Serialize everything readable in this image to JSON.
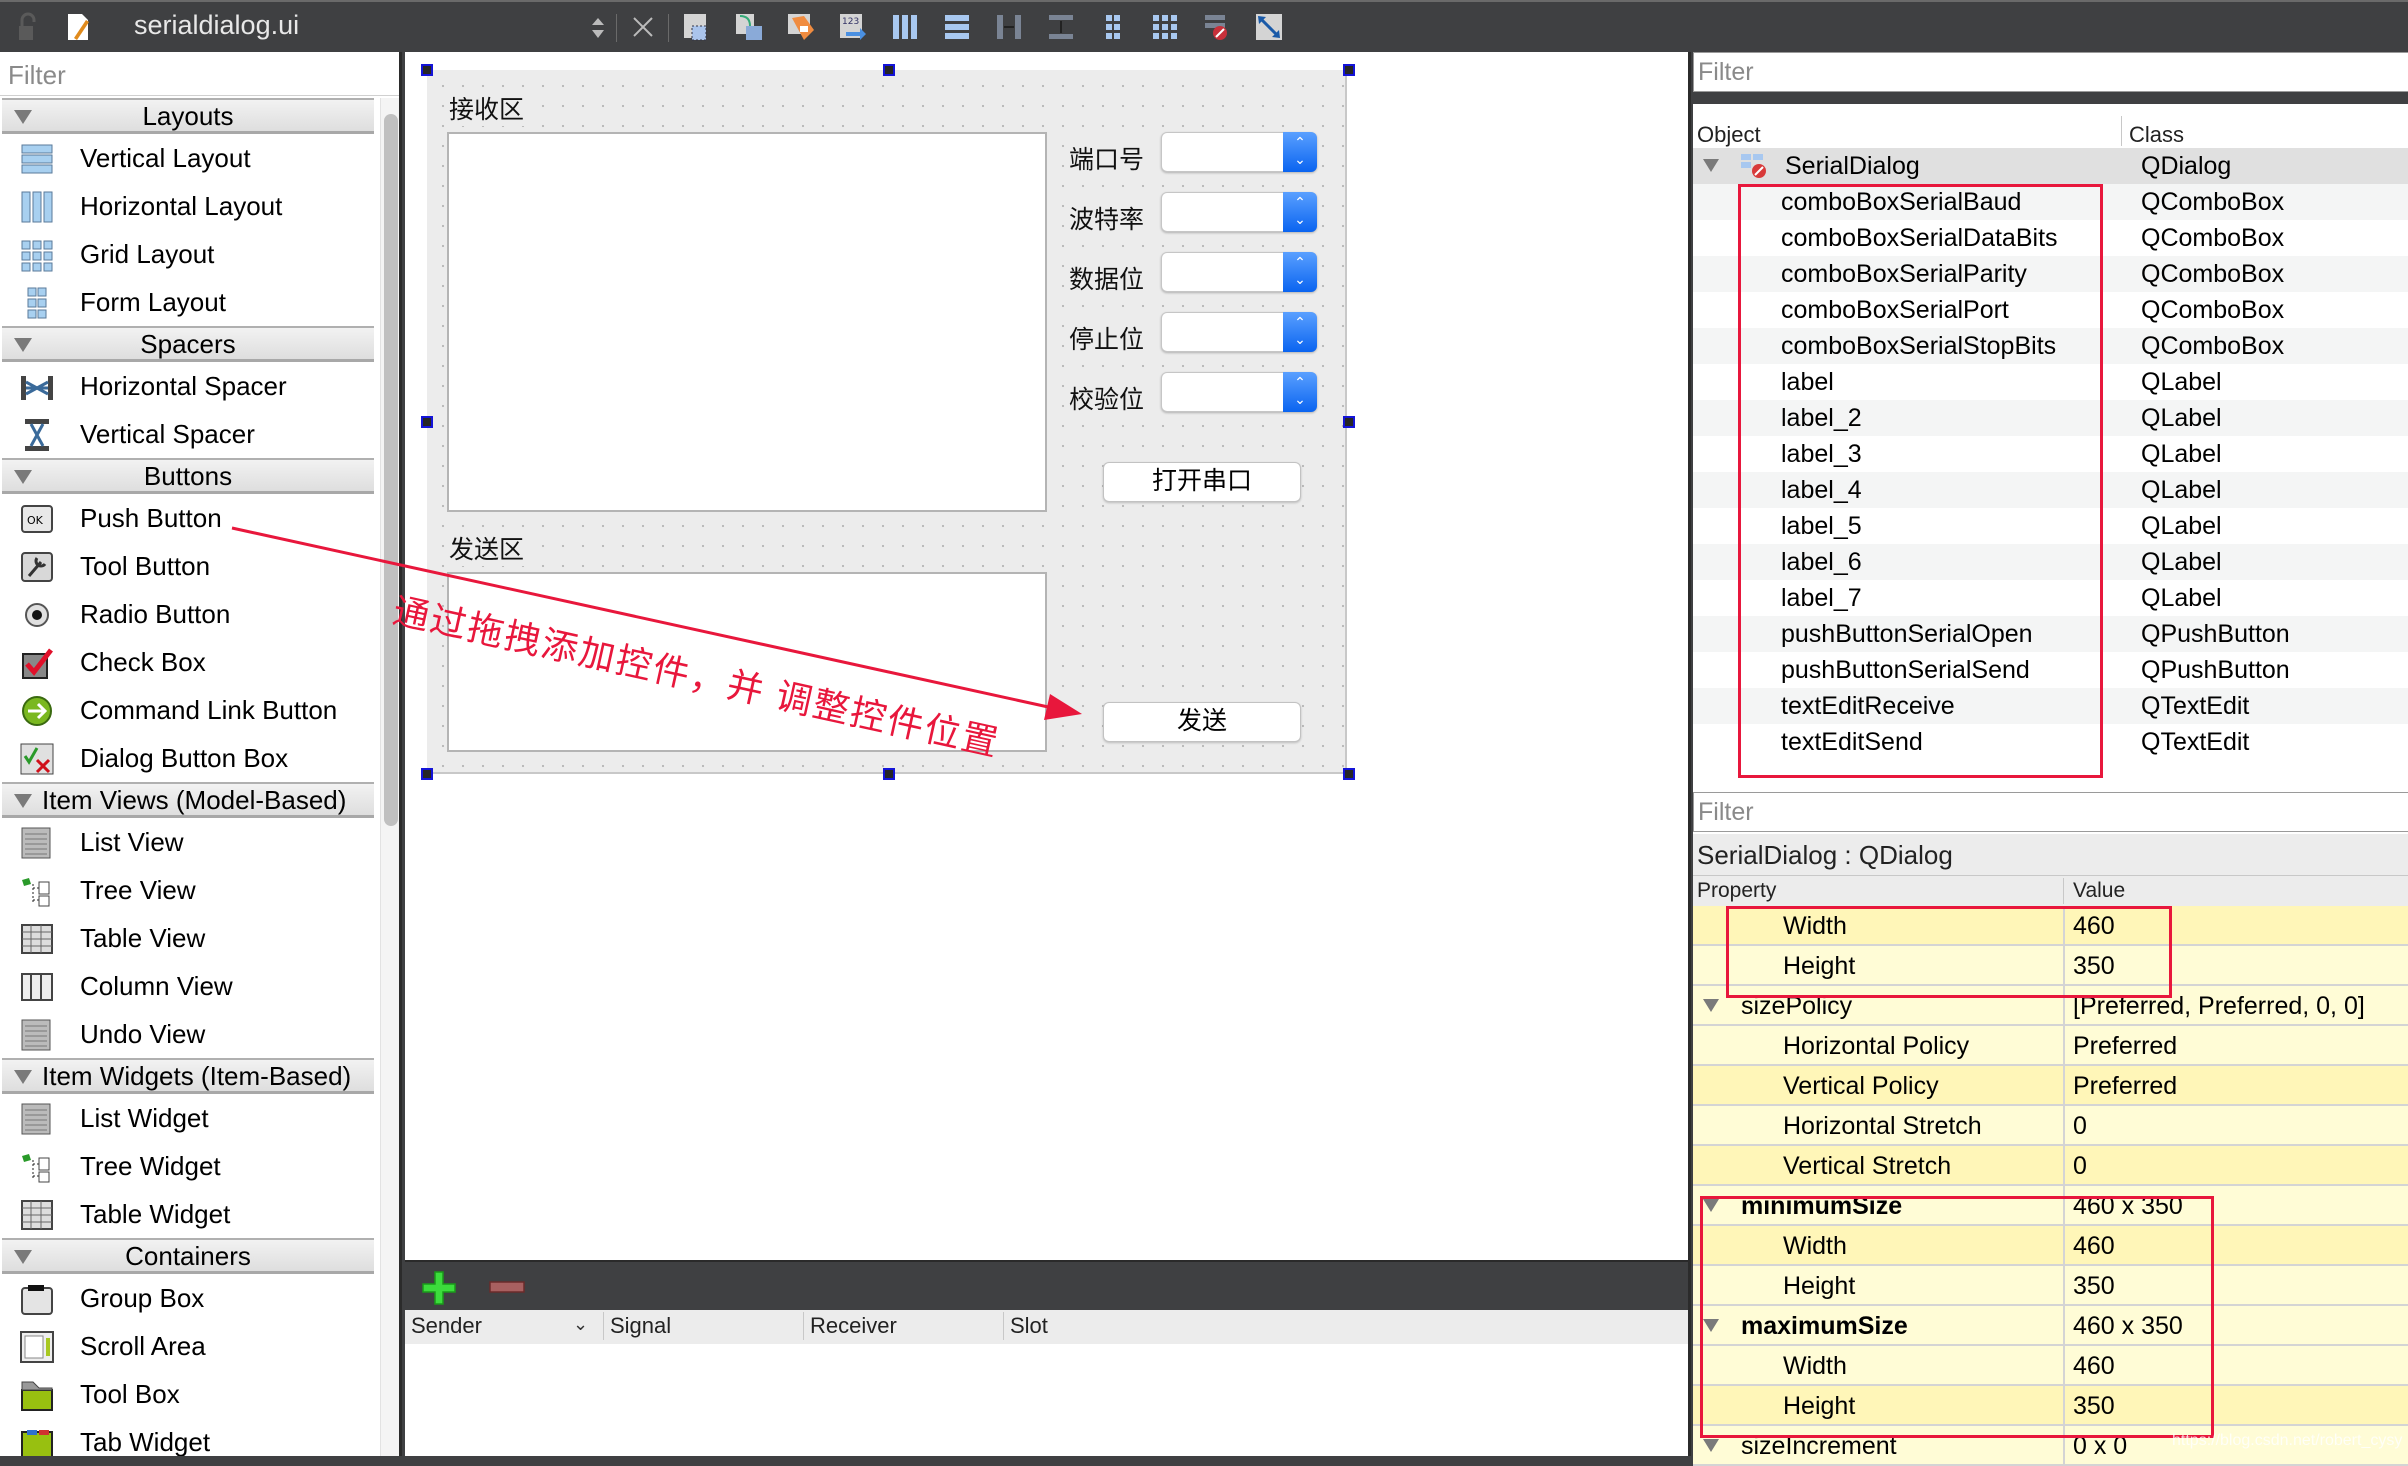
{
  "toolbar": {
    "document_title": "serialdialog.ui",
    "icons": [
      "lock-icon",
      "document-edit-icon",
      "up-down-arrows-icon",
      "close-icon",
      "edit-widgets-icon",
      "edit-signals-slots-icon",
      "edit-buddies-icon",
      "edit-tab-order-icon",
      "layout-horizontal-icon",
      "layout-vertical-icon",
      "layout-horizontal-splitter-icon",
      "layout-vertical-splitter-icon",
      "layout-form-icon",
      "layout-grid-icon",
      "break-layout-icon",
      "adjust-size-icon"
    ]
  },
  "widget_box": {
    "filter_placeholder": "Filter",
    "categories": [
      {
        "label": "Layouts",
        "items": [
          {
            "label": "Vertical Layout",
            "icon": "vertical-layout-icon"
          },
          {
            "label": "Horizontal Layout",
            "icon": "horizontal-layout-icon"
          },
          {
            "label": "Grid Layout",
            "icon": "grid-layout-icon"
          },
          {
            "label": "Form Layout",
            "icon": "form-layout-icon"
          }
        ]
      },
      {
        "label": "Spacers",
        "items": [
          {
            "label": "Horizontal Spacer",
            "icon": "horizontal-spacer-icon"
          },
          {
            "label": "Vertical Spacer",
            "icon": "vertical-spacer-icon"
          }
        ]
      },
      {
        "label": "Buttons",
        "items": [
          {
            "label": "Push Button",
            "icon": "push-button-icon"
          },
          {
            "label": "Tool Button",
            "icon": "tool-button-icon"
          },
          {
            "label": "Radio Button",
            "icon": "radio-button-icon"
          },
          {
            "label": "Check Box",
            "icon": "check-box-icon"
          },
          {
            "label": "Command Link Button",
            "icon": "command-link-icon"
          },
          {
            "label": "Dialog Button Box",
            "icon": "dialog-button-box-icon"
          }
        ]
      },
      {
        "label": "Item Views (Model-Based)",
        "items": [
          {
            "label": "List View",
            "icon": "list-view-icon"
          },
          {
            "label": "Tree View",
            "icon": "tree-view-icon"
          },
          {
            "label": "Table View",
            "icon": "table-view-icon"
          },
          {
            "label": "Column View",
            "icon": "column-view-icon"
          },
          {
            "label": "Undo View",
            "icon": "undo-view-icon"
          }
        ]
      },
      {
        "label": "Item Widgets (Item-Based)",
        "items": [
          {
            "label": "List Widget",
            "icon": "list-widget-icon"
          },
          {
            "label": "Tree Widget",
            "icon": "tree-widget-icon"
          },
          {
            "label": "Table Widget",
            "icon": "table-widget-icon"
          }
        ]
      },
      {
        "label": "Containers",
        "items": [
          {
            "label": "Group Box",
            "icon": "group-box-icon"
          },
          {
            "label": "Scroll Area",
            "icon": "scroll-area-icon"
          },
          {
            "label": "Tool Box",
            "icon": "tool-box-icon"
          },
          {
            "label": "Tab Widget",
            "icon": "tab-widget-icon"
          }
        ]
      }
    ]
  },
  "form": {
    "receive_label": "接收区",
    "send_label": "发送区",
    "settings": [
      {
        "label": "端口号",
        "value": ""
      },
      {
        "label": "波特率",
        "value": ""
      },
      {
        "label": "数据位",
        "value": ""
      },
      {
        "label": "停止位",
        "value": ""
      },
      {
        "label": "校验位",
        "value": ""
      }
    ],
    "open_button": "打开串口",
    "send_button": "发送"
  },
  "annotation": {
    "text": "通过拖拽添加控件，并  调整控件位置",
    "color": "#e8173c"
  },
  "signal_slot_editor": {
    "columns": [
      "Sender",
      "Signal",
      "Receiver",
      "Slot"
    ],
    "add_icon": "add-connection-icon",
    "remove_icon": "remove-connection-icon"
  },
  "object_inspector": {
    "filter_placeholder": "Filter",
    "columns": {
      "object": "Object",
      "class": "Class"
    },
    "root": {
      "object": "SerialDialog",
      "class": "QDialog"
    },
    "children": [
      {
        "object": "comboBoxSerialBaud",
        "class": "QComboBox"
      },
      {
        "object": "comboBoxSerialDataBits",
        "class": "QComboBox"
      },
      {
        "object": "comboBoxSerialParity",
        "class": "QComboBox"
      },
      {
        "object": "comboBoxSerialPort",
        "class": "QComboBox"
      },
      {
        "object": "comboBoxSerialStopBits",
        "class": "QComboBox"
      },
      {
        "object": "label",
        "class": "QLabel"
      },
      {
        "object": "label_2",
        "class": "QLabel"
      },
      {
        "object": "label_3",
        "class": "QLabel"
      },
      {
        "object": "label_4",
        "class": "QLabel"
      },
      {
        "object": "label_5",
        "class": "QLabel"
      },
      {
        "object": "label_6",
        "class": "QLabel"
      },
      {
        "object": "label_7",
        "class": "QLabel"
      },
      {
        "object": "pushButtonSerialOpen",
        "class": "QPushButton"
      },
      {
        "object": "pushButtonSerialSend",
        "class": "QPushButton"
      },
      {
        "object": "textEditReceive",
        "class": "QTextEdit"
      },
      {
        "object": "textEditSend",
        "class": "QTextEdit"
      }
    ]
  },
  "property_editor": {
    "filter_placeholder": "Filter",
    "title": "SerialDialog : QDialog",
    "columns": {
      "property": "Property",
      "value": "Value"
    },
    "rows": [
      {
        "name": "Width",
        "value": "460",
        "level": 1
      },
      {
        "name": "Height",
        "value": "350",
        "level": 1
      },
      {
        "name": "sizePolicy",
        "value": "[Preferred, Preferred, 0, 0]",
        "level": 0
      },
      {
        "name": "Horizontal Policy",
        "value": "Preferred",
        "level": 1
      },
      {
        "name": "Vertical Policy",
        "value": "Preferred",
        "level": 1
      },
      {
        "name": "Horizontal Stretch",
        "value": "0",
        "level": 1
      },
      {
        "name": "Vertical Stretch",
        "value": "0",
        "level": 1
      },
      {
        "name": "minimumSize",
        "value": "460 x 350",
        "level": 0,
        "bold": true
      },
      {
        "name": "Width",
        "value": "460",
        "level": 1
      },
      {
        "name": "Height",
        "value": "350",
        "level": 1
      },
      {
        "name": "maximumSize",
        "value": "460 x 350",
        "level": 0,
        "bold": true
      },
      {
        "name": "Width",
        "value": "460",
        "level": 1
      },
      {
        "name": "Height",
        "value": "350",
        "level": 1
      },
      {
        "name": "sizeIncrement",
        "value": "0 x 0",
        "level": 0
      }
    ]
  },
  "watermark": "https://blog.csdn.net/robert_cysy"
}
